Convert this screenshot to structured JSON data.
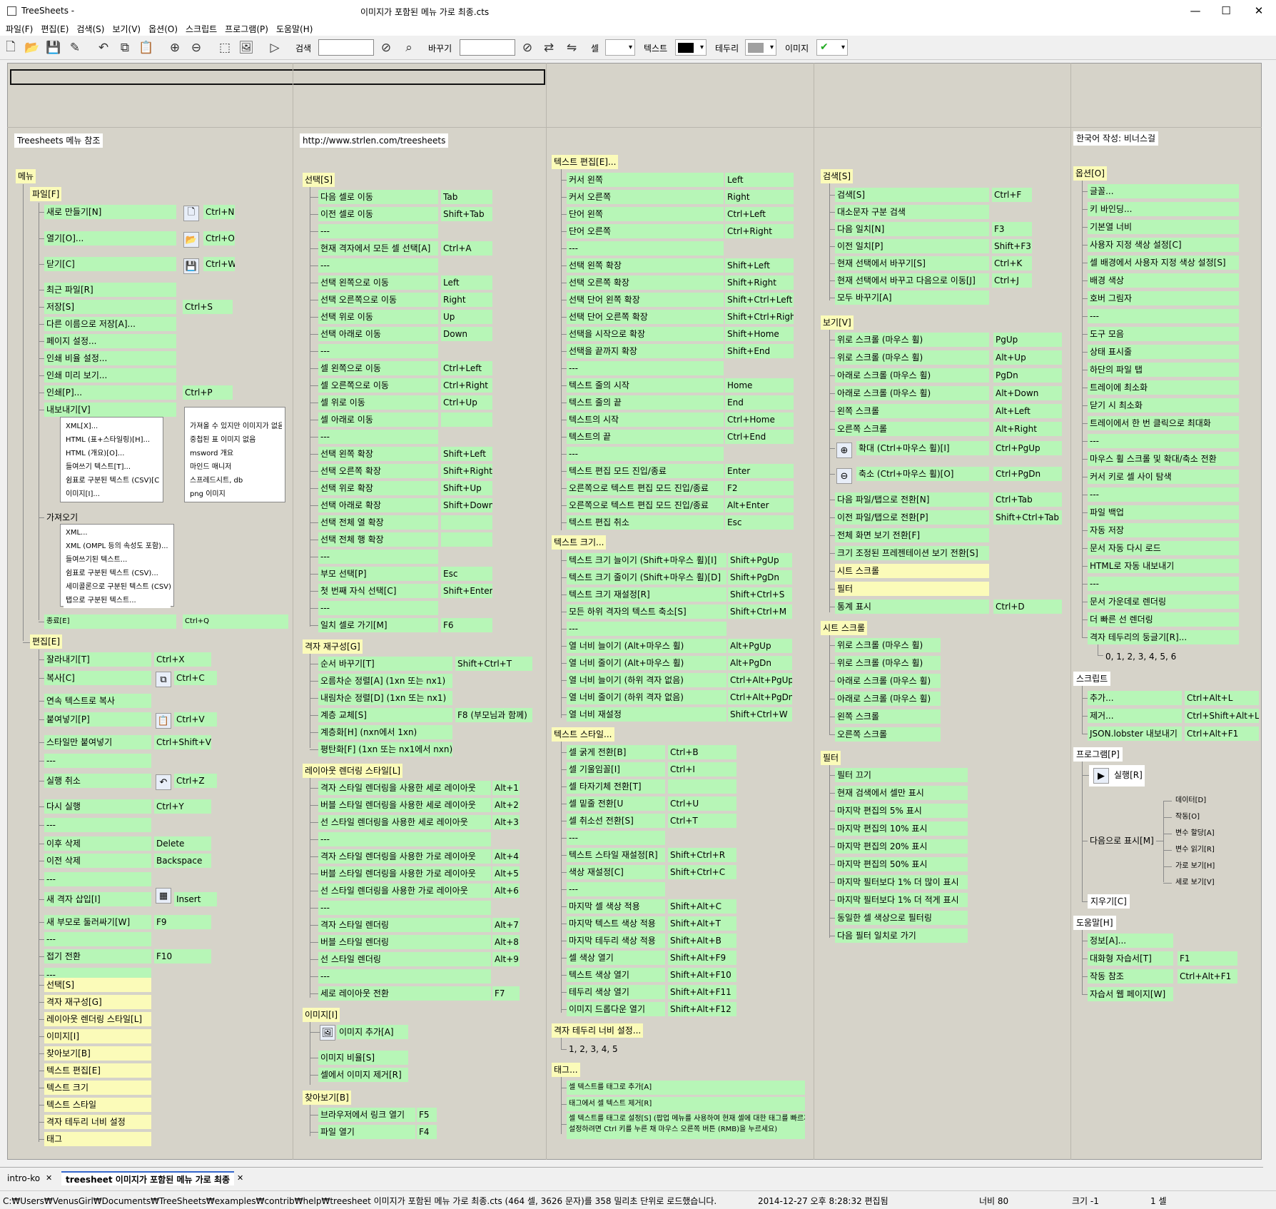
{
  "app_title": "TreeSheets -",
  "doc_title": "이미지가 포함된 메뉴 가로 최종.cts",
  "window_controls": {
    "minimize": "—",
    "maximize": "☐",
    "close": "✕"
  },
  "menu": [
    "파일(F)",
    "편집(E)",
    "검색(S)",
    "보기(V)",
    "옵션(O)",
    "스크립트",
    "프로그램(P)",
    "도움말(H)"
  ],
  "toolbar": {
    "search_label": "검색",
    "replace_label": "바꾸기",
    "cell_label": "셀",
    "text_label": "텍스트",
    "border_label": "테두리",
    "image_label": "이미지",
    "icons": [
      "new-file-icon",
      "open-folder-icon",
      "save-icon",
      "save-as-icon",
      "undo-icon",
      "copy-icon",
      "paste-icon",
      "zoom-in-icon",
      "zoom-out-icon",
      "select-icon",
      "add-image-icon",
      "run-icon"
    ],
    "text_color": "#000000",
    "border_color": "#a0a0a0"
  },
  "colors": {
    "cell_green": "#b7f6b7",
    "cell_yellow": "#fbfbb9",
    "canvas": "#d6d3c9"
  },
  "headers": {
    "ref": "Treesheets 메뉴 참조",
    "url": "http://www.strlen.com/treesheets",
    "author": "한국어 작성: 비너스걸"
  },
  "c1": {
    "root": "메뉴",
    "file": "파일[F]",
    "edit": "편집[E]",
    "file_items": [
      [
        "새로 만들기[N]",
        "Ctrl+N"
      ],
      [
        "열기[O]...",
        "Ctrl+O"
      ],
      [
        "닫기[C]",
        "Ctrl+W"
      ],
      [
        "최근 파일[R]",
        ""
      ],
      [
        "저장[S]",
        "Ctrl+S"
      ],
      [
        "다른 이름으로 저장[A]...",
        ""
      ],
      [
        "페이지 설정...",
        ""
      ],
      [
        "인쇄 비율 설정...",
        ""
      ],
      [
        "인쇄 미리 보기...",
        ""
      ],
      [
        "인쇄[P]...",
        "Ctrl+P"
      ],
      [
        "내보내기[V]",
        ""
      ]
    ],
    "export_a": [
      "XML[X]...",
      "HTML (표+스타일링)[H]...",
      "HTML (개요)[O]...",
      "들여쓰기 텍스트[T]...",
      "쉼표로 구분된 텍스트 (CSV)[C]...",
      "이미지[I]..."
    ],
    "export_b": [
      "가져올 수 있지만 이미지가 없음",
      "중첩된 표 이미지 없음",
      "msword 개요",
      "마인드 매니저",
      "스프레드시트, db",
      "png 이미지"
    ],
    "import_label": "가져오기",
    "import_items": [
      "XML...",
      "XML (OMPL 등의 속성도 포함)...",
      "들여쓰기된 텍스트...",
      "쉼표로 구분된 텍스트 (CSV)...",
      "세미콜론으로 구분된 텍스트 (CSV)...",
      "탭으로 구분된 텍스트..."
    ],
    "quit": [
      "종료[E]",
      "Ctrl+Q"
    ],
    "edit_items": [
      [
        "잘라내기[T]",
        "Ctrl+X"
      ],
      [
        "복사[C]",
        "Ctrl+C"
      ],
      [
        "연속 텍스트로 복사",
        ""
      ],
      [
        "붙여넣기[P]",
        "Ctrl+V"
      ],
      [
        "스타일만 붙여넣기",
        "Ctrl+Shift+V"
      ],
      [
        "---",
        ""
      ],
      [
        "실행 취소",
        "Ctrl+Z"
      ],
      [
        "다시 실행",
        "Ctrl+Y"
      ],
      [
        "---",
        ""
      ],
      [
        "이후 삭제",
        "Delete"
      ],
      [
        "이전 삭제",
        "Backspace"
      ],
      [
        "---",
        ""
      ],
      [
        "새 격자 삽입[I]",
        "Insert"
      ],
      [
        "새 부모로 둘러싸기[W]",
        "F9"
      ],
      [
        "---",
        ""
      ],
      [
        "접기 전환",
        "F10"
      ],
      [
        "---",
        ""
      ]
    ],
    "edit_sub": [
      "선택[S]",
      "격자 재구성[G]",
      "레이아웃 렌더링 스타일[L]",
      "이미지[I]",
      "찾아보기[B]",
      "텍스트 편집[E]",
      "텍스트 크기",
      "텍스트 스타일",
      "격자 테두리 너비 설정",
      "태그"
    ]
  },
  "c2": {
    "select_label": "선택[S]",
    "select_items": [
      [
        "다음 셀로 이동",
        "Tab"
      ],
      [
        "이전 셀로 이동",
        "Shift+Tab"
      ],
      [
        "---",
        ""
      ],
      [
        "현재 격자에서 모든 셀 선택[A]",
        "Ctrl+A"
      ],
      [
        "---",
        ""
      ],
      [
        "선택 왼쪽으로 이동",
        "Left"
      ],
      [
        "선택 오른쪽으로 이동",
        "Right"
      ],
      [
        "선택 위로 이동",
        "Up"
      ],
      [
        "선택 아래로 이동",
        "Down"
      ],
      [
        "---",
        ""
      ],
      [
        "셀 왼쪽으로 이동",
        "Ctrl+Left"
      ],
      [
        "셀 오른쪽으로 이동",
        "Ctrl+Right"
      ],
      [
        "셀 위로 이동",
        "Ctrl+Up"
      ],
      [
        "셀 아래로 이동",
        ""
      ],
      [
        "---",
        ""
      ],
      [
        "선택 왼쪽 확장",
        "Shift+Left"
      ],
      [
        "선택 오른쪽 확장",
        "Shift+Right"
      ],
      [
        "선택 위로 확장",
        "Shift+Up"
      ],
      [
        "선택 아래로 확장",
        "Shift+Down"
      ],
      [
        "선택 전체 열 확장",
        ""
      ],
      [
        "선택 전체 행 확장",
        ""
      ],
      [
        "---",
        ""
      ],
      [
        "부모 선택[P]",
        "Esc"
      ],
      [
        "첫 번째 자식 선택[C]",
        "Shift+Enter"
      ],
      [
        "---",
        ""
      ],
      [
        "일치 셀로 가기[M]",
        "F6"
      ]
    ],
    "grid_label": "격자 재구성[G]",
    "grid_items": [
      [
        "순서 바꾸기[T]",
        "Shift+Ctrl+T"
      ],
      [
        "오름차순 정렬[A] (1xn 또는 nx1)",
        ""
      ],
      [
        "내림차순 정렬[D] (1xn 또는 nx1)",
        ""
      ],
      [
        "계층 교체[S]",
        "F8 (부모님과 함께)"
      ],
      [
        "계층화[H] (nxn에서 1xn)",
        ""
      ],
      [
        "평탄화[F] (1xn 또는 nx1에서 nxn)",
        ""
      ]
    ],
    "layout_label": "레이아웃 렌더링 스타일[L]",
    "layout_items": [
      [
        "격자 스타일 렌더링을 사용한 세로 레이아웃",
        "Alt+1"
      ],
      [
        "버블 스타일 렌더링을 사용한 세로 레이아웃",
        "Alt+2"
      ],
      [
        "선 스타일 렌더링을 사용한 세로 레이아웃",
        "Alt+3"
      ],
      [
        "---",
        ""
      ],
      [
        "격자 스타일 렌더링을 사용한 가로 레이아웃",
        "Alt+4"
      ],
      [
        "버블 스타일 렌더링을 사용한 가로 레이아웃",
        "Alt+5"
      ],
      [
        "선 스타일 렌더링을 사용한 가로 레이아웃",
        "Alt+6"
      ],
      [
        "---",
        ""
      ],
      [
        "격자 스타일 렌더링",
        "Alt+7"
      ],
      [
        "버블 스타일 렌더링",
        "Alt+8"
      ],
      [
        "선 스타일 렌더링",
        "Alt+9"
      ],
      [
        "---",
        ""
      ],
      [
        "세로 레이아웃 전환",
        "F7"
      ]
    ],
    "image_label": "이미지[I]",
    "image_items": [
      "이미지 추가[A]",
      "이미지 비율[S]",
      "셀에서 이미지 제거[R]"
    ],
    "browse_label": "찾아보기[B]",
    "browse_items": [
      [
        "브라우저에서 링크 열기",
        "F5"
      ],
      [
        "파일 열기",
        "F4"
      ]
    ]
  },
  "c3": {
    "textedit_label": "텍스트 편집[E]...",
    "textedit_items": [
      [
        "커서 왼쪽",
        "Left"
      ],
      [
        "커서 오른쪽",
        "Right"
      ],
      [
        "단어 왼쪽",
        "Ctrl+Left"
      ],
      [
        "단어 오른쪽",
        "Ctrl+Right"
      ],
      [
        "---",
        ""
      ],
      [
        "선택 왼쪽 확장",
        "Shift+Left"
      ],
      [
        "선택 오른쪽 확장",
        "Shift+Right"
      ],
      [
        "선택 단어 왼쪽 확장",
        "Shift+Ctrl+Left"
      ],
      [
        "선택 단어 오른쪽 확장",
        "Shift+Ctrl+Right"
      ],
      [
        "선택을 시작으로 확장",
        "Shift+Home"
      ],
      [
        "선택을 끝까지 확장",
        "Shift+End"
      ],
      [
        "---",
        ""
      ],
      [
        "텍스트 줄의 시작",
        "Home"
      ],
      [
        "텍스트 줄의 끝",
        "End"
      ],
      [
        "텍스트의 시작",
        "Ctrl+Home"
      ],
      [
        "텍스트의 끝",
        "Ctrl+End"
      ],
      [
        "---",
        ""
      ],
      [
        "텍스트 편집 모드 진입/종료",
        "Enter"
      ],
      [
        "오른쪽으로 텍스트 편집 모드 진입/종료",
        "F2"
      ],
      [
        "오른쪽으로 텍스트 편집 모드 진입/종료",
        "Alt+Enter"
      ],
      [
        "텍스트 편집 취소",
        "Esc"
      ]
    ],
    "textsize_label": "텍스트 크기...",
    "textsize_items": [
      [
        "텍스트 크기 늘이기 (Shift+마우스 휠)[I]",
        "Shift+PgUp"
      ],
      [
        "텍스트 크기 줄이기 (Shift+마우스 휠)[D]",
        "Shift+PgDn"
      ],
      [
        "텍스트 크기 재설정[R]",
        "Shift+Ctrl+S"
      ],
      [
        "모든 하위 격자의 텍스트 축소[S]",
        "Shift+Ctrl+M"
      ],
      [
        "---",
        ""
      ],
      [
        "열 너비 늘이기 (Alt+마우스 휠)",
        "Alt+PgUp"
      ],
      [
        "열 너비 줄이기 (Alt+마우스 휠)",
        "Alt+PgDn"
      ],
      [
        "열 너비 늘이기 (하위 격자 없음)",
        "Ctrl+Alt+PgUp"
      ],
      [
        "열 너비 줄이기 (하위 격자 없음)",
        "Ctrl+Alt+PgDn"
      ],
      [
        "열 너비 재설정",
        "Shift+Ctrl+W"
      ]
    ],
    "textstyle_label": "텍스트 스타일...",
    "textstyle_items": [
      [
        "셀 굵게 전환[B]",
        "Ctrl+B"
      ],
      [
        "셀 기울임꼴[I]",
        "Ctrl+I"
      ],
      [
        "셀 타자기체 전환[T]",
        ""
      ],
      [
        "셀 밑줄 전환[U",
        "Ctrl+U"
      ],
      [
        "셀 취소선 전환[S]",
        "Ctrl+T"
      ],
      [
        "---",
        ""
      ],
      [
        "텍스트 스타일 재설정[R]",
        "Shift+Ctrl+R"
      ],
      [
        "색상 재설정[C]",
        "Shift+Ctrl+C"
      ],
      [
        "---",
        ""
      ],
      [
        "마지막 셀 색상 적용",
        "Shift+Alt+C"
      ],
      [
        "마지막 텍스트 색상 적용",
        "Shift+Alt+T"
      ],
      [
        "마지막 테두리 색상 적용",
        "Shift+Alt+B"
      ],
      [
        "셀 색상 열기",
        "Shift+Alt+F9"
      ],
      [
        "텍스트 색상 열기",
        "Shift+Alt+F10"
      ],
      [
        "테두리 색상 열기",
        "Shift+Alt+F11"
      ],
      [
        "이미지 드롭다운 열기",
        "Shift+Alt+F12"
      ]
    ],
    "border_label": "격자 테두리 너비 설정...",
    "border_values": "1, 2, 3, 4, 5",
    "tag_label": "태그...",
    "tag_items": [
      "셀 텍스트를 태그로 추가[A]",
      "태그에서 셀 텍스트 제거[R]",
      "셀 텍스트를 태그로 설정[S] (팝업 메뉴를 사용하여 현재 셀에 대한 태그를 빠르게",
      "설정하려면 Ctrl 키를 누른 채 마우스 오른쪽 버튼 (RMB)을 누르세요)"
    ]
  },
  "c4": {
    "search_label": "검색[S]",
    "search_items": [
      [
        "검색[S]",
        "Ctrl+F"
      ],
      [
        "대소문자 구분 검색",
        ""
      ],
      [
        "다음 일치[N]",
        "F3"
      ],
      [
        "이전 일치[P]",
        "Shift+F3"
      ],
      [
        "현재 선택에서 바꾸기[S]",
        "Ctrl+K"
      ],
      [
        "현재 선택에서 바꾸고 다음으로 이동[J]",
        "Ctrl+J"
      ],
      [
        "모두 바꾸기[A]",
        ""
      ]
    ],
    "view_label": "보기[V]",
    "view_items": [
      [
        "위로 스크롤 (마우스 휠)",
        "PgUp"
      ],
      [
        "위로 스크롤 (마우스 휠)",
        "Alt+Up"
      ],
      [
        "아래로 스크롤 (마우스 휠)",
        "PgDn"
      ],
      [
        "아래로 스크롤 (마우스 휠)",
        "Alt+Down"
      ],
      [
        "왼쪽 스크롤",
        "Alt+Left"
      ],
      [
        "오른쪽 스크롤",
        "Alt+Right"
      ],
      [
        "확대 (Ctrl+마우스 휠)[I]",
        "Ctrl+PgUp"
      ],
      [
        "축소 (Ctrl+마우스 휠)[O]",
        "Ctrl+PgDn"
      ],
      [
        "다음 파일/탭으로 전환[N]",
        "Ctrl+Tab"
      ],
      [
        "이전 파일/탭으로 전환[P]",
        "Shift+Ctrl+Tab"
      ],
      [
        "전체 화면 보기 전환[F]",
        ""
      ],
      [
        "크기 조정된 프레젠테이션 보기 전환[S]",
        ""
      ],
      [
        "시트 스크롤",
        ""
      ],
      [
        "필터",
        ""
      ],
      [
        "통계 표시",
        "Ctrl+D"
      ]
    ],
    "sheet_label": "시트 스크롤",
    "sheet_items": [
      "위로 스크롤 (마우스 휠)",
      "위로 스크롤 (마우스 휠)",
      "아래로 스크롤 (마우스 휠)",
      "아래로 스크롤 (마우스 휠)",
      "왼쪽 스크롤",
      "오른쪽 스크롤"
    ],
    "filter_label": "필터",
    "filter_items": [
      "필터 끄기",
      "현재 검색에서 셀만 표시",
      "마지막 편집의 5% 표시",
      "마지막 편집의 10% 표시",
      "마지막 편집의 20% 표시",
      "마지막 편집의 50% 표시",
      "마지막 필터보다 1% 더 많이 표시",
      "마지막 필터보다 1% 더 적게 표시",
      "동일한 셀 색상으로 필터링",
      "다음 필터 일치로 가기"
    ]
  },
  "c5": {
    "options_label": "옵션[O]",
    "options_items": [
      "글꼴...",
      "키 바인딩...",
      "기본열 너비",
      "사용자 지정 색상 설정[C]",
      "셀 배경에서 사용자 지정 색상 설정[S]",
      "배경 색상",
      "호버 그림자",
      "---",
      "도구 모음",
      "상태 표시줄",
      "하단의 파일 탭",
      "트레이에 최소화",
      "닫기 시 최소화",
      "트레이에서 한 번 클릭으로 최대화",
      "---",
      "마우스 휠 스크롤 및 확대/축소 전환",
      "커서 키로 셀 사이 탐색",
      "---",
      "파일 백업",
      "자동 저장",
      "문서 자동 다시 로드",
      "HTML로 자동 내보내기",
      "---",
      "문서 가운데로 렌더링",
      "더 빠른 선 렌더링",
      "격자 테두리의 둥글기[R]..."
    ],
    "roundness_values": "0, 1, 2, 3, 4, 5, 6",
    "script_label": "스크립트",
    "script_items": [
      [
        "추가...",
        "Ctrl+Alt+L"
      ],
      [
        "제거...",
        "Ctrl+Shift+Alt+L"
      ],
      [
        "JSON.lobster 내보내기",
        "Ctrl+Alt+F1"
      ]
    ],
    "program_label": "프로그램[P]",
    "run_label": "실행[R]",
    "showas_label": "다음으로 표시[M]",
    "showas_items": [
      "데이터[D]",
      "작동[O]",
      "변수 할당[A]",
      "변수 읽기[R]",
      "가로 보기[H]",
      "세로 보기[V]"
    ],
    "clear_label": "지우기[C]",
    "help_label": "도움말[H]",
    "help_items": [
      [
        "정보[A]...",
        ""
      ],
      [
        "대화형 자습서[T]",
        "F1"
      ],
      [
        "작동 참조",
        "Ctrl+Alt+F1"
      ],
      [
        "자습서 웹 페이지[W]",
        ""
      ]
    ]
  },
  "tabs": {
    "t1": "intro-ko",
    "t2": "treesheet 이미지가 포함된 메뉴 가로 최종",
    "close": "✕"
  },
  "status": {
    "message": "C:₩Users₩VenusGirl₩Documents₩TreeSheets₩examples₩contrib₩help₩treesheet 이미지가 포함된 메뉴 가로 최종.cts (464 셀, 3626 문자)를 358 밀리초 단위로 로드했습니다.",
    "datetime": "2014-12-27 오후 8:28:32 편집됨",
    "width": "너비 80",
    "size": "크기 -1",
    "cells": "1 셀"
  }
}
